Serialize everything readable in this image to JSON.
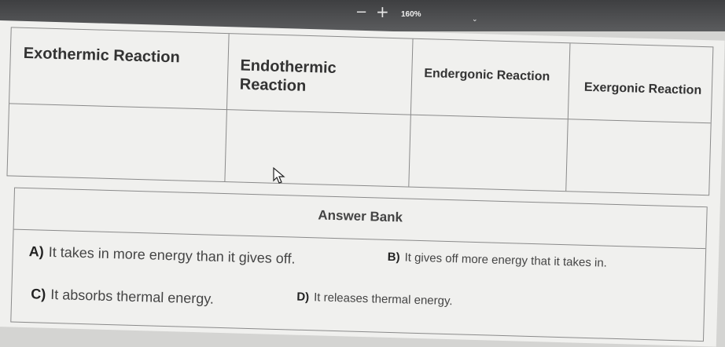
{
  "toolbar": {
    "zoom_level": "160%"
  },
  "table": {
    "headers": [
      "Exothermic Reaction",
      "Endothermic Reaction",
      "Endergonic Reaction",
      "Exergonic Reaction"
    ]
  },
  "answer_bank": {
    "title": "Answer Bank",
    "options": [
      {
        "letter": "A)",
        "text": "It takes in more energy than it gives off."
      },
      {
        "letter": "B)",
        "text": "It gives off more energy that it takes in."
      },
      {
        "letter": "C)",
        "text": "It absorbs thermal energy."
      },
      {
        "letter": "D)",
        "text": "It releases thermal energy."
      }
    ]
  }
}
